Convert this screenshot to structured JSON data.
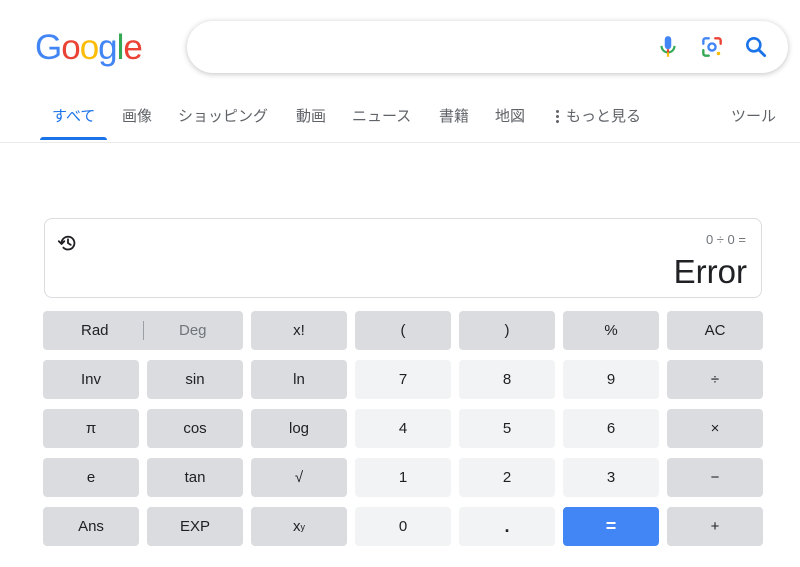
{
  "logo": {
    "letters": [
      {
        "ch": "G",
        "color": "#4285f4"
      },
      {
        "ch": "o",
        "color": "#ea4335"
      },
      {
        "ch": "o",
        "color": "#fbbc05"
      },
      {
        "ch": "g",
        "color": "#4285f4"
      },
      {
        "ch": "l",
        "color": "#34a853"
      },
      {
        "ch": "e",
        "color": "#ea4335"
      }
    ]
  },
  "search": {
    "value": "",
    "icons": [
      "microphone-icon",
      "google-lens-icon",
      "search-icon"
    ]
  },
  "tabs": {
    "all": "すべて",
    "images": "画像",
    "shopping": "ショッピング",
    "videos": "動画",
    "news": "ニュース",
    "books": "書籍",
    "maps": "地図",
    "more": "もっと見る",
    "tools": "ツール"
  },
  "calculator": {
    "expression": "0 ÷ 0 =",
    "result": "Error",
    "keys": {
      "rad": "Rad",
      "deg": "Deg",
      "fact": "x!",
      "lparen": "(",
      "rparen": ")",
      "percent": "%",
      "ac": "AC",
      "inv": "Inv",
      "sin": "sin",
      "ln": "ln",
      "seven": "7",
      "eight": "8",
      "nine": "9",
      "divide": "÷",
      "pi": "π",
      "cos": "cos",
      "log": "log",
      "four": "4",
      "five": "5",
      "six": "6",
      "multiply": "×",
      "e": "e",
      "tan": "tan",
      "sqrt": "√",
      "one": "1",
      "two": "2",
      "three": "3",
      "minus": "−",
      "ans": "Ans",
      "exp": "EXP",
      "pow_base": "x",
      "pow_exp": "y",
      "zero": "0",
      "dot": ".",
      "equals": "=",
      "plus": "+"
    }
  },
  "colors": {
    "accent": "#1a73e8",
    "equals_button": "#4285f4",
    "key_dark": "#dadce0",
    "key_light": "#f1f3f4"
  }
}
